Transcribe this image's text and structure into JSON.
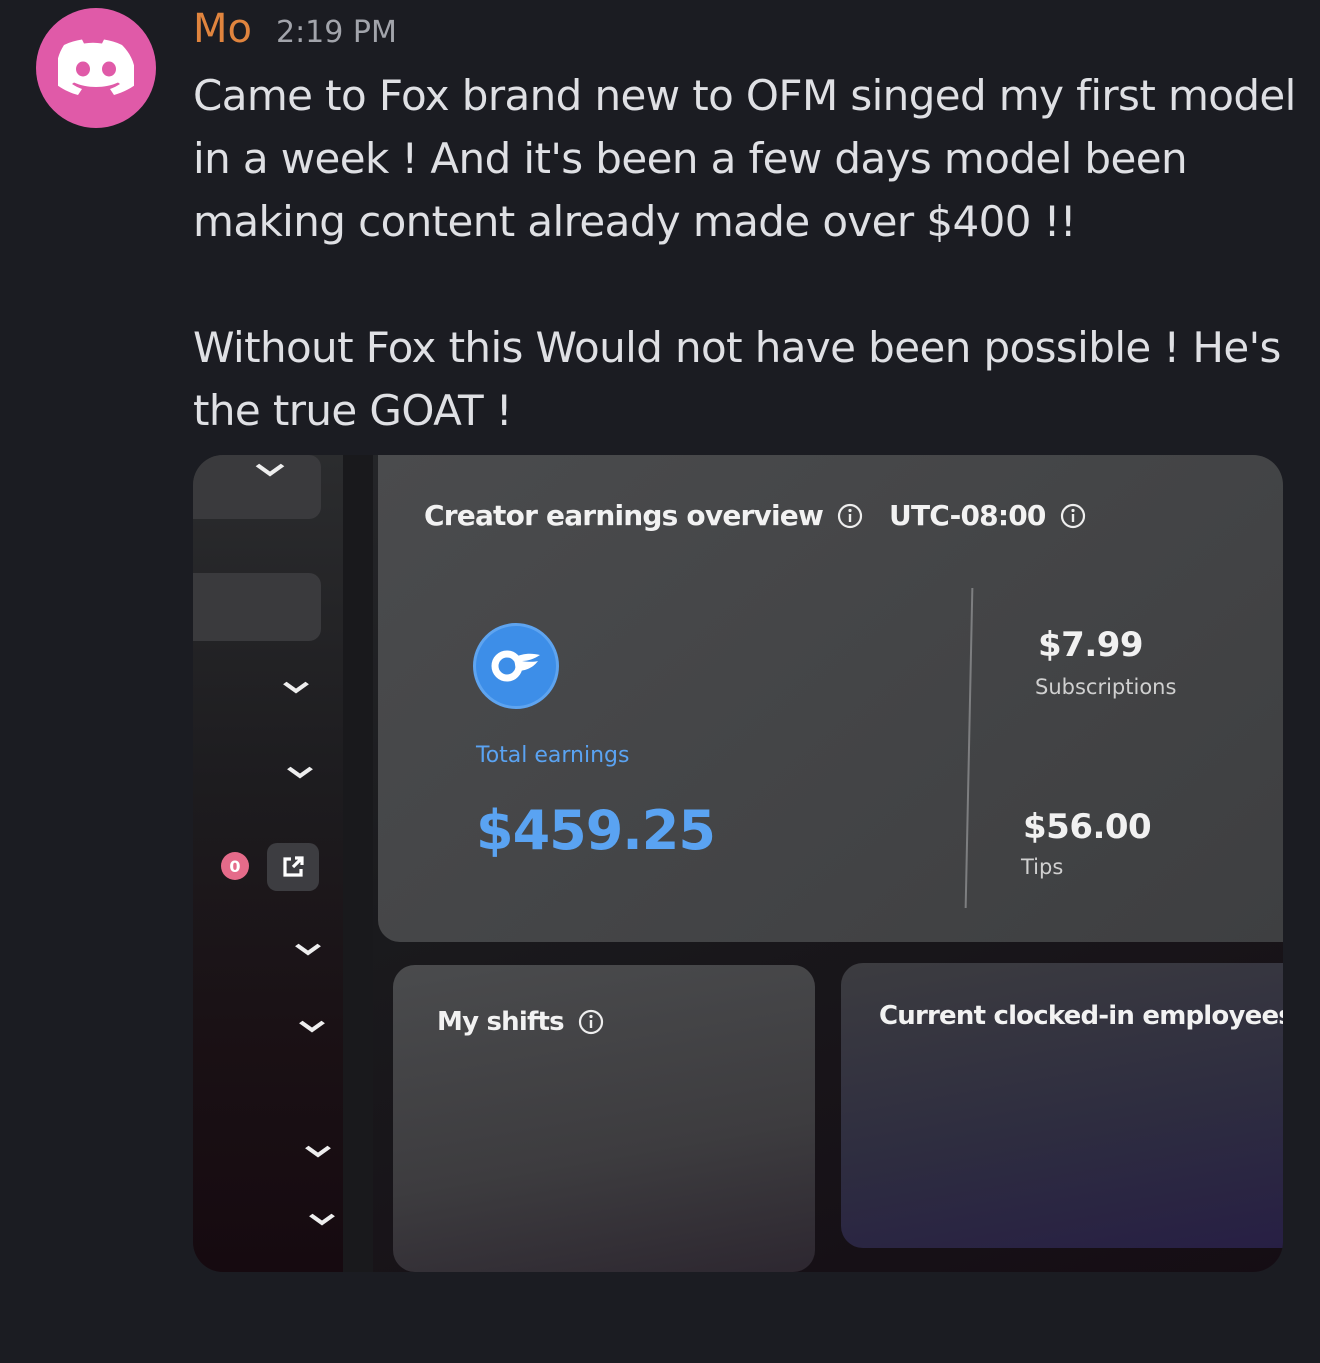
{
  "message": {
    "username": "Mo",
    "timestamp": "2:19 PM",
    "avatar_icon": "discord-logo-icon",
    "avatar_color": "#e05aa8",
    "username_color": "#e0843e",
    "lines": [
      "Came to Fox brand new to OFM singed my first model",
      "in a week ! And it's been a few days model been",
      "making content already made over $400 !!"
    ],
    "lines2": [
      "Without Fox this Would not have been possible ! He's",
      "the true GOAT !"
    ]
  },
  "attachment": {
    "overview": {
      "title": "Creator earnings overview",
      "timezone": "UTC-08:00",
      "total_label": "Total earnings",
      "total_value": "$459.25",
      "subscriptions_value": "$7.99",
      "subscriptions_label": "Subscriptions",
      "tips_value": "$56.00",
      "tips_label": "Tips"
    },
    "shifts_title": "My shifts",
    "clocked_title": "Current clocked-in employees",
    "badge_count": "0"
  }
}
